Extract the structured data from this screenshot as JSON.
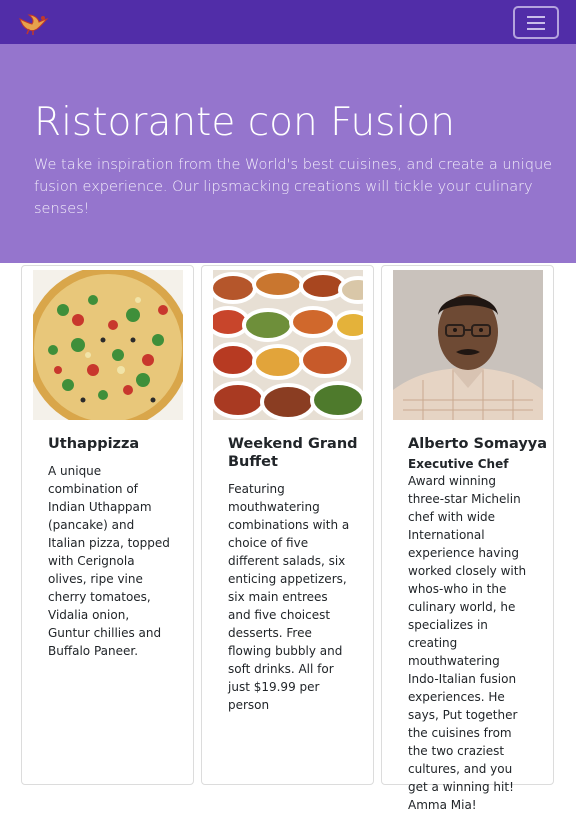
{
  "navbar": {
    "logo_icon": "bird-logo-icon",
    "toggler_icon": "hamburger-menu-icon",
    "brand_color": "#512da8"
  },
  "jumbotron": {
    "title": "Ristorante con Fusion",
    "text": "We take inspiration from the World's best cuisines, and create a unique fusion experience. Our lipsmacking creations will tickle your culinary senses!",
    "background_color": "#9575cd"
  },
  "cards": [
    {
      "image": "pizza-image",
      "title": "Uthappizza",
      "subtitle": "",
      "text": "A unique combination of Indian Uthappam (pancake) and Italian pizza, topped with Cerignola olives, ripe vine cherry tomatoes, Vidalia onion, Guntur chillies and Buffalo Paneer."
    },
    {
      "image": "buffet-image",
      "title": "Weekend Grand Buffet",
      "subtitle": "",
      "text": "Featuring mouthwatering combinations with a choice of five different salads, six enticing appetizers, six main entrees and five choicest desserts. Free flowing bubbly and soft drinks. All for just $19.99 per person"
    },
    {
      "image": "chef-photo",
      "title": "Alberto Somayya",
      "subtitle": "Executive Chef",
      "text": "Award winning three-star Michelin chef with wide International experience having worked closely with whos-who in the culinary world, he specializes in creating mouthwatering Indo-Italian fusion experiences. He says, Put together the cuisines from the two craziest cultures, and you get a winning hit! Amma Mia!"
    }
  ]
}
